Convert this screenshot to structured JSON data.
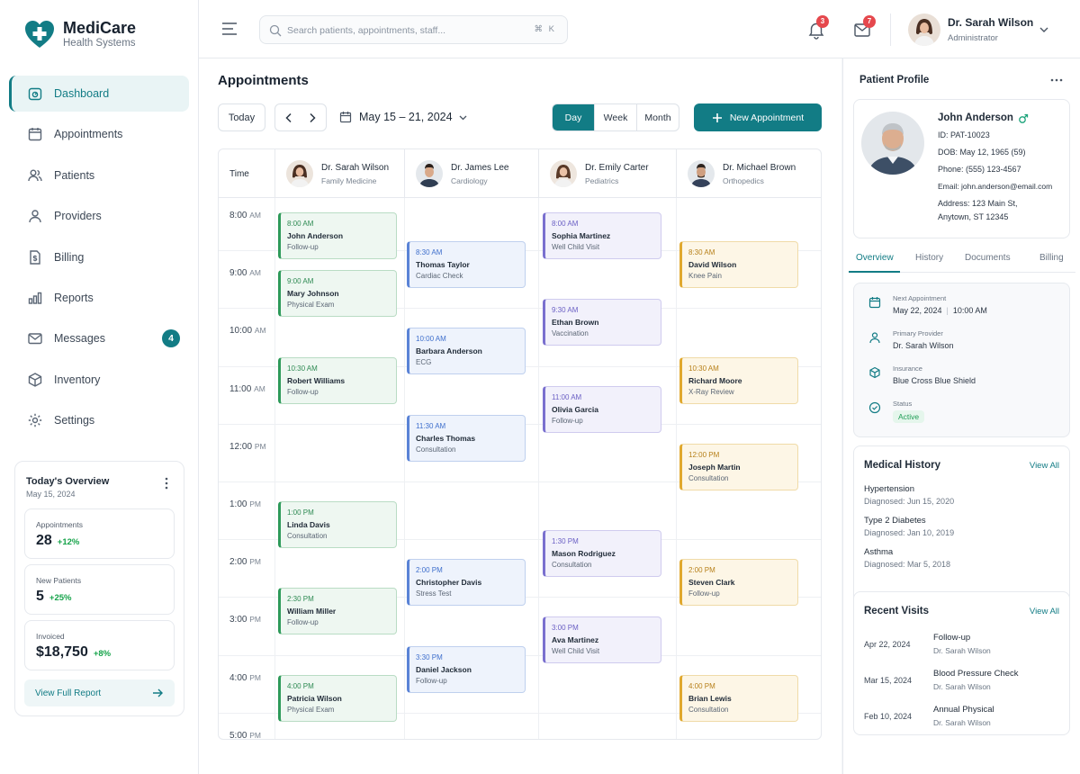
{
  "brand": {
    "name": "MediCare",
    "subtitle": "Health Systems"
  },
  "sidebar": {
    "items": [
      {
        "label": "Dashboard",
        "icon": "dashboard-icon",
        "active": true
      },
      {
        "label": "Appointments",
        "icon": "calendar-icon"
      },
      {
        "label": "Patients",
        "icon": "users-icon"
      },
      {
        "label": "Providers",
        "icon": "user-icon"
      },
      {
        "label": "Billing",
        "icon": "billing-icon"
      },
      {
        "label": "Reports",
        "icon": "bar-chart-icon"
      },
      {
        "label": "Messages",
        "icon": "mail-icon",
        "badge": "4"
      },
      {
        "label": "Inventory",
        "icon": "box-icon"
      },
      {
        "label": "Settings",
        "icon": "gear-icon"
      }
    ]
  },
  "overview": {
    "title": "Today's Overview",
    "date": "May 15, 2024",
    "cards": [
      {
        "label": "Appointments",
        "value": "28",
        "change": "+12%"
      },
      {
        "label": "New Patients",
        "value": "5",
        "change": "+25%"
      },
      {
        "label": "Invoiced",
        "value": "$18,750",
        "change": "+8%"
      }
    ],
    "link": "View Full Report"
  },
  "topbar": {
    "search_placeholder": "Search patients, appointments, staff...",
    "shortcut": "⌘ K",
    "notifications_count": "3",
    "messages_count": "7",
    "user_name": "Dr. Sarah Wilson",
    "user_role": "Administrator"
  },
  "main": {
    "title": "Appointments",
    "today_label": "Today",
    "date_range": "May 15 – 21, 2024",
    "views": [
      "Day",
      "Week",
      "Month"
    ],
    "active_view": "Day",
    "new_appointment": "New Appointment",
    "time_header": "Time"
  },
  "doctors": [
    {
      "name": "Dr. Sarah Wilson",
      "specialty": "Family Medicine"
    },
    {
      "name": "Dr. James Lee",
      "specialty": "Cardiology"
    },
    {
      "name": "Dr. Emily Carter",
      "specialty": "Pediatrics"
    },
    {
      "name": "Dr. Michael Brown",
      "specialty": "Orthopedics"
    }
  ],
  "time_slots": [
    {
      "hour": "8:00",
      "ampm": "AM"
    },
    {
      "hour": "9:00",
      "ampm": "AM"
    },
    {
      "hour": "10:00",
      "ampm": "AM"
    },
    {
      "hour": "11:00",
      "ampm": "AM"
    },
    {
      "hour": "12:00",
      "ampm": "PM"
    },
    {
      "hour": "1:00",
      "ampm": "PM"
    },
    {
      "hour": "2:00",
      "ampm": "PM"
    },
    {
      "hour": "3:00",
      "ampm": "PM"
    },
    {
      "hour": "4:00",
      "ampm": "PM"
    },
    {
      "hour": "5:00",
      "ampm": "PM"
    }
  ],
  "appointments": [
    {
      "doctor": 0,
      "time": "8:00 AM",
      "patient": "John Anderson",
      "type": "Follow-up",
      "color": "green"
    },
    {
      "doctor": 0,
      "time": "9:00 AM",
      "patient": "Mary Johnson",
      "type": "Physical Exam",
      "color": "green"
    },
    {
      "doctor": 0,
      "time": "10:30 AM",
      "patient": "Robert Williams",
      "type": "Follow-up",
      "color": "green"
    },
    {
      "doctor": 0,
      "time": "1:00 PM",
      "patient": "Linda Davis",
      "type": "Consultation",
      "color": "green"
    },
    {
      "doctor": 0,
      "time": "2:30 PM",
      "patient": "William Miller",
      "type": "Follow-up",
      "color": "green"
    },
    {
      "doctor": 0,
      "time": "4:00 PM",
      "patient": "Patricia Wilson",
      "type": "Physical Exam",
      "color": "green"
    },
    {
      "doctor": 1,
      "time": "8:30 AM",
      "patient": "Thomas Taylor",
      "type": "Cardiac Check",
      "color": "blue"
    },
    {
      "doctor": 1,
      "time": "10:00 AM",
      "patient": "Barbara Anderson",
      "type": "ECG",
      "color": "blue"
    },
    {
      "doctor": 1,
      "time": "11:30 AM",
      "patient": "Charles Thomas",
      "type": "Consultation",
      "color": "blue"
    },
    {
      "doctor": 1,
      "time": "2:00 PM",
      "patient": "Christopher Davis",
      "type": "Stress Test",
      "color": "blue"
    },
    {
      "doctor": 1,
      "time": "3:30 PM",
      "patient": "Daniel Jackson",
      "type": "Follow-up",
      "color": "blue"
    },
    {
      "doctor": 2,
      "time": "8:00 AM",
      "patient": "Sophia Martinez",
      "type": "Well Child Visit",
      "color": "purple"
    },
    {
      "doctor": 2,
      "time": "9:30 AM",
      "patient": "Ethan Brown",
      "type": "Vaccination",
      "color": "purple"
    },
    {
      "doctor": 2,
      "time": "11:00 AM",
      "patient": "Olivia Garcia",
      "type": "Follow-up",
      "color": "purple"
    },
    {
      "doctor": 2,
      "time": "1:30 PM",
      "patient": "Mason Rodriguez",
      "type": "Consultation",
      "color": "purple"
    },
    {
      "doctor": 2,
      "time": "3:00 PM",
      "patient": "Ava Martinez",
      "type": "Well Child Visit",
      "color": "purple"
    },
    {
      "doctor": 3,
      "time": "8:30 AM",
      "patient": "David Wilson",
      "type": "Knee Pain",
      "color": "yellow"
    },
    {
      "doctor": 3,
      "time": "10:30 AM",
      "patient": "Richard Moore",
      "type": "X-Ray Review",
      "color": "yellow"
    },
    {
      "doctor": 3,
      "time": "12:00 PM",
      "patient": "Joseph Martin",
      "type": "Consultation",
      "color": "yellow"
    },
    {
      "doctor": 3,
      "time": "2:00 PM",
      "patient": "Steven Clark",
      "type": "Follow-up",
      "color": "yellow"
    },
    {
      "doctor": 3,
      "time": "4:00 PM",
      "patient": "Brian Lewis",
      "type": "Consultation",
      "color": "yellow"
    }
  ],
  "patient": {
    "panel_title": "Patient Profile",
    "name": "John Anderson",
    "id": "ID: PAT-10023",
    "dob": "DOB: May 12, 1965 (59)",
    "phone": "Phone: (555) 123-4567",
    "email": "Email: john.anderson@email.com",
    "address1": "Address: 123 Main St,",
    "address2": "Anytown, ST 12345",
    "tabs": [
      "Overview",
      "History",
      "Documents",
      "Billing"
    ],
    "active_tab": "Overview",
    "next_appt_label": "Next Appointment",
    "next_appt_date": "May 22, 2024",
    "next_appt_time": "10:00 AM",
    "provider_label": "Primary Provider",
    "provider": "Dr. Sarah Wilson",
    "insurance_label": "Insurance",
    "insurance": "Blue Cross Blue Shield",
    "status_label": "Status",
    "status": "Active"
  },
  "medical_history": {
    "title": "Medical History",
    "view_all": "View All",
    "items": [
      {
        "condition": "Hypertension",
        "diagnosed": "Diagnosed: Jun 15, 2020"
      },
      {
        "condition": "Type 2 Diabetes",
        "diagnosed": "Diagnosed: Jan 10, 2019"
      },
      {
        "condition": "Asthma",
        "diagnosed": "Diagnosed: Mar 5, 2018"
      }
    ]
  },
  "recent_visits": {
    "title": "Recent Visits",
    "view_all": "View All",
    "items": [
      {
        "date": "Apr 22, 2024",
        "type": "Follow-up",
        "doctor": "Dr. Sarah Wilson"
      },
      {
        "date": "Mar 15, 2024",
        "type": "Blood Pressure Check",
        "doctor": "Dr. Sarah Wilson"
      },
      {
        "date": "Feb 10, 2024",
        "type": "Annual Physical",
        "doctor": "Dr. Sarah Wilson"
      }
    ]
  },
  "colors": {
    "accent": "#127c85",
    "green": "#2e9a5a",
    "blue": "#5a83d6",
    "purple": "#7a70cf",
    "yellow": "#e0a82e"
  }
}
